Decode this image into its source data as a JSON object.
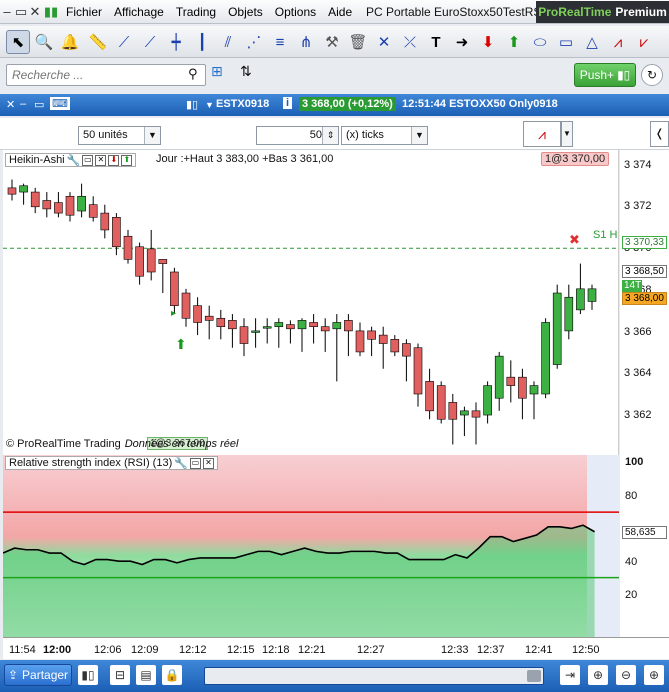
{
  "menu": {
    "items": [
      "Fichier",
      "Affichage",
      "Trading",
      "Objets",
      "Options",
      "Aide"
    ],
    "window_title": "PC Portable EuroStoxx50TestRSI",
    "brand_a": "ProRealTime",
    "brand_b": "Premium"
  },
  "toolbar": {
    "search_placeholder": "Recherche ...",
    "push_label": "Push+"
  },
  "chart_header": {
    "instrument": "ESTX0918",
    "price": "3 368,00 (+0,12%)",
    "info": "12:51:44 ESTOXX50 Only0918"
  },
  "chart_toolbar": {
    "units": "50 unités",
    "ticks_value": "50",
    "ticks_label": "(x) ticks"
  },
  "price_chart": {
    "indicator": "Heikin-Ashi",
    "ohlc_text": "Jour :+Haut 3 383,00 +Bas 3 361,00",
    "trade_label": "1@3 370,00",
    "trade_label2": "1@3 367,00",
    "copyright": "© ProRealTime Trading",
    "data_note": "Données en temps réel",
    "s1_label": "S1 H",
    "last_price_tag": "14T",
    "level_s1": "3 370,33",
    "level_bid": "3 368,50",
    "level_last": "3 368,00",
    "y_ticks": [
      "3 374",
      "3 372",
      "3 370",
      "3 368",
      "3 366",
      "3 364",
      "3 362"
    ]
  },
  "rsi": {
    "label": "Relative strength index (RSI) (13)",
    "y_ticks": [
      "100",
      "80",
      "40",
      "20"
    ],
    "current_value": "58,635"
  },
  "colors": {
    "up": "#3cb043",
    "down": "#e06060",
    "rsi_fill_top": "#f3a6a6",
    "rsi_fill_bottom": "#8fdc9e",
    "line_overbought": "#e00000",
    "line_oversold": "#1aa51a"
  },
  "time_axis": [
    "11:54",
    "12:00",
    "12:06",
    "12:09",
    "12:12",
    "12:15",
    "12:18",
    "12:21",
    "12:27",
    "12:33",
    "12:37",
    "12:41",
    "12:50"
  ],
  "bottom": {
    "share_label": "Partager"
  },
  "chart_data": {
    "type": "candlestick",
    "title": "",
    "y_axis_ticks": [
      3374,
      3372,
      3370,
      3368,
      3366,
      3364,
      3362
    ],
    "candles": [
      {
        "o": 3373.2,
        "h": 3373.6,
        "l": 3372.6,
        "c": 3372.9,
        "up": false
      },
      {
        "o": 3373.0,
        "h": 3373.4,
        "l": 3372.4,
        "c": 3373.3,
        "up": true
      },
      {
        "o": 3373.0,
        "h": 3373.2,
        "l": 3372.0,
        "c": 3372.3,
        "up": false
      },
      {
        "o": 3372.6,
        "h": 3373.0,
        "l": 3371.8,
        "c": 3372.2,
        "up": false
      },
      {
        "o": 3372.5,
        "h": 3373.0,
        "l": 3371.8,
        "c": 3372.0,
        "up": false
      },
      {
        "o": 3372.8,
        "h": 3373.0,
        "l": 3371.6,
        "c": 3371.9,
        "up": false
      },
      {
        "o": 3372.1,
        "h": 3373.4,
        "l": 3371.8,
        "c": 3372.8,
        "up": true
      },
      {
        "o": 3372.4,
        "h": 3372.8,
        "l": 3371.6,
        "c": 3371.8,
        "up": false
      },
      {
        "o": 3372.0,
        "h": 3372.4,
        "l": 3370.8,
        "c": 3371.2,
        "up": false
      },
      {
        "o": 3371.8,
        "h": 3372.0,
        "l": 3370.0,
        "c": 3370.4,
        "up": false
      },
      {
        "o": 3370.9,
        "h": 3371.2,
        "l": 3369.6,
        "c": 3369.8,
        "up": false
      },
      {
        "o": 3370.4,
        "h": 3370.6,
        "l": 3368.6,
        "c": 3369.0,
        "up": false
      },
      {
        "o": 3370.3,
        "h": 3371.2,
        "l": 3368.8,
        "c": 3369.2,
        "up": false
      },
      {
        "o": 3369.6,
        "h": 3369.8,
        "l": 3368.2,
        "c": 3369.8,
        "up": false
      },
      {
        "o": 3369.2,
        "h": 3369.4,
        "l": 3367.2,
        "c": 3367.6,
        "up": false
      },
      {
        "o": 3368.2,
        "h": 3368.4,
        "l": 3366.6,
        "c": 3367.0,
        "up": false
      },
      {
        "o": 3367.6,
        "h": 3368.0,
        "l": 3366.2,
        "c": 3366.8,
        "up": false
      },
      {
        "o": 3367.1,
        "h": 3367.6,
        "l": 3366.0,
        "c": 3366.9,
        "up": false
      },
      {
        "o": 3367.0,
        "h": 3367.4,
        "l": 3366.0,
        "c": 3366.6,
        "up": false
      },
      {
        "o": 3366.9,
        "h": 3367.2,
        "l": 3365.6,
        "c": 3366.5,
        "up": false
      },
      {
        "o": 3366.6,
        "h": 3367.0,
        "l": 3365.2,
        "c": 3365.8,
        "up": false
      },
      {
        "o": 3366.4,
        "h": 3367.0,
        "l": 3365.6,
        "c": 3366.4,
        "up": true
      },
      {
        "o": 3366.6,
        "h": 3367.0,
        "l": 3365.8,
        "c": 3366.6,
        "up": true
      },
      {
        "o": 3366.6,
        "h": 3367.0,
        "l": 3365.6,
        "c": 3366.8,
        "up": true
      },
      {
        "o": 3366.7,
        "h": 3366.9,
        "l": 3365.8,
        "c": 3366.5,
        "up": false
      },
      {
        "o": 3366.5,
        "h": 3367.0,
        "l": 3365.4,
        "c": 3366.9,
        "up": true
      },
      {
        "o": 3366.8,
        "h": 3367.2,
        "l": 3365.8,
        "c": 3366.6,
        "up": false
      },
      {
        "o": 3366.6,
        "h": 3367.0,
        "l": 3365.4,
        "c": 3366.4,
        "up": false
      },
      {
        "o": 3366.5,
        "h": 3367.2,
        "l": 3364.0,
        "c": 3366.8,
        "up": true
      },
      {
        "o": 3366.9,
        "h": 3367.2,
        "l": 3365.2,
        "c": 3366.4,
        "up": false
      },
      {
        "o": 3366.4,
        "h": 3366.8,
        "l": 3365.2,
        "c": 3365.4,
        "up": false
      },
      {
        "o": 3366.4,
        "h": 3366.6,
        "l": 3365.2,
        "c": 3366.0,
        "up": false
      },
      {
        "o": 3366.2,
        "h": 3366.6,
        "l": 3364.6,
        "c": 3365.8,
        "up": false
      },
      {
        "o": 3366.0,
        "h": 3366.2,
        "l": 3365.2,
        "c": 3365.4,
        "up": false
      },
      {
        "o": 3365.8,
        "h": 3366.0,
        "l": 3364.0,
        "c": 3365.2,
        "up": false
      },
      {
        "o": 3365.6,
        "h": 3365.8,
        "l": 3362.8,
        "c": 3363.4,
        "up": false
      },
      {
        "o": 3364.0,
        "h": 3364.6,
        "l": 3362.2,
        "c": 3362.6,
        "up": false
      },
      {
        "o": 3363.8,
        "h": 3364.0,
        "l": 3362.0,
        "c": 3362.2,
        "up": false
      },
      {
        "o": 3363.0,
        "h": 3363.4,
        "l": 3361.0,
        "c": 3362.2,
        "up": false
      },
      {
        "o": 3362.4,
        "h": 3362.8,
        "l": 3361.4,
        "c": 3362.6,
        "up": true
      },
      {
        "o": 3362.6,
        "h": 3363.0,
        "l": 3361.0,
        "c": 3362.3,
        "up": false
      },
      {
        "o": 3362.4,
        "h": 3364.0,
        "l": 3362.0,
        "c": 3363.8,
        "up": true
      },
      {
        "o": 3363.2,
        "h": 3365.4,
        "l": 3362.6,
        "c": 3365.2,
        "up": true
      },
      {
        "o": 3364.2,
        "h": 3365.0,
        "l": 3363.0,
        "c": 3363.8,
        "up": false
      },
      {
        "o": 3364.2,
        "h": 3364.6,
        "l": 3362.2,
        "c": 3363.2,
        "up": false
      },
      {
        "o": 3363.4,
        "h": 3364.0,
        "l": 3362.2,
        "c": 3363.8,
        "up": true
      },
      {
        "o": 3363.4,
        "h": 3367.0,
        "l": 3363.2,
        "c": 3366.8,
        "up": true
      },
      {
        "o": 3364.8,
        "h": 3368.6,
        "l": 3364.6,
        "c": 3368.2,
        "up": true
      },
      {
        "o": 3366.4,
        "h": 3368.6,
        "l": 3366.0,
        "c": 3368.0,
        "up": true
      },
      {
        "o": 3367.4,
        "h": 3369.6,
        "l": 3367.2,
        "c": 3368.4,
        "up": true
      },
      {
        "o": 3367.8,
        "h": 3368.6,
        "l": 3367.4,
        "c": 3368.4,
        "up": true
      }
    ],
    "rsi_series": [
      45,
      48,
      47,
      47,
      45,
      45,
      40,
      38,
      41,
      41,
      40,
      40,
      38,
      41,
      41,
      39,
      41,
      42,
      42,
      42,
      42,
      44,
      46,
      46,
      44,
      46,
      48,
      46,
      45,
      45,
      46,
      46,
      46,
      45,
      45,
      41,
      41,
      41,
      41,
      44,
      42,
      48,
      55,
      55,
      52,
      54,
      56,
      61,
      61,
      60,
      62,
      58
    ],
    "rsi_levels": {
      "overbought": 70,
      "oversold": 30
    },
    "rsi_range": [
      0,
      100
    ],
    "price_range": [
      3360.5,
      3375
    ]
  }
}
